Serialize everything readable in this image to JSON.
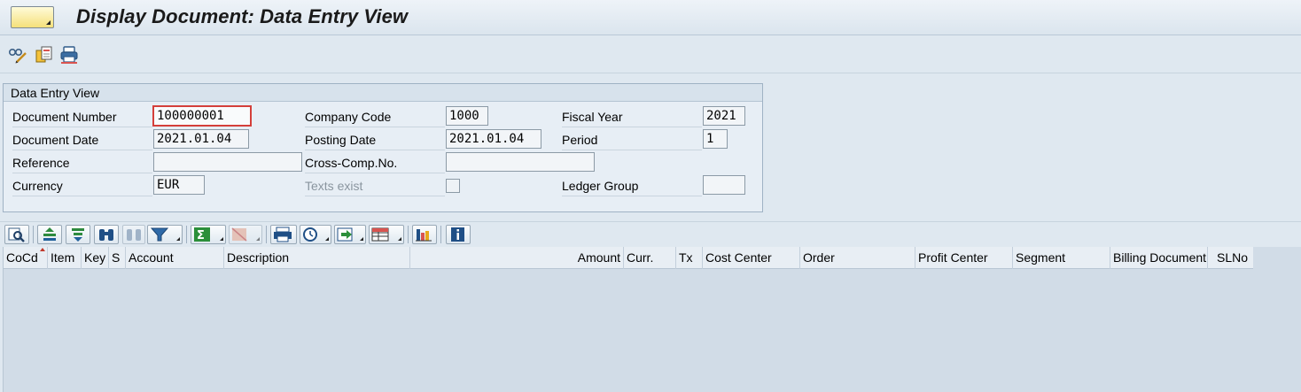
{
  "window": {
    "title": "Display Document: Data Entry View"
  },
  "toolbar": {
    "icons": [
      "glasses-pencil-icon",
      "documents-icon",
      "printer-icon"
    ]
  },
  "group": {
    "title": "Data Entry View",
    "fields": {
      "document_number_label": "Document Number",
      "document_number": "100000001",
      "company_code_label": "Company Code",
      "company_code": "1000",
      "fiscal_year_label": "Fiscal Year",
      "fiscal_year": "2021",
      "document_date_label": "Document Date",
      "document_date": "2021.01.04",
      "posting_date_label": "Posting Date",
      "posting_date": "2021.01.04",
      "period_label": "Period",
      "period": "1",
      "reference_label": "Reference",
      "reference": "",
      "cross_comp_label": "Cross-Comp.No.",
      "cross_comp": "",
      "currency_label": "Currency",
      "currency": "EUR",
      "texts_exist_label": "Texts exist",
      "ledger_group_label": "Ledger Group",
      "ledger_group": ""
    }
  },
  "grid": {
    "columns": [
      "CoCd",
      "Item",
      "Key",
      "S",
      "Account",
      "Description",
      "Amount",
      "Curr.",
      "Tx",
      "Cost Center",
      "Order",
      "Profit Center",
      "Segment",
      "Billing Document",
      "SLNo"
    ]
  },
  "colors": {
    "focus_border": "#d43f3a",
    "background": "#dfe8f0"
  }
}
